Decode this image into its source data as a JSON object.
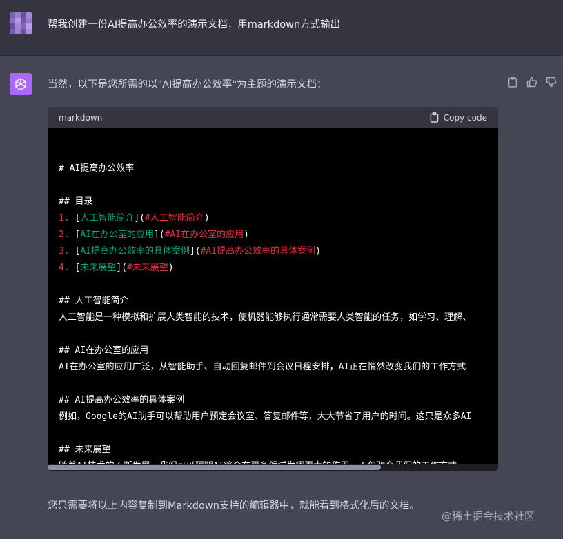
{
  "user": {
    "message": "帮我创建一份AI提高办公效率的演示文档，用markdown方式输出"
  },
  "assistant": {
    "intro": "当然，以下是您所需的以\"AI提高办公效率\"为主题的演示文档：",
    "outro": "您只需要将以上内容复制到Markdown支持的编辑器中，就能看到格式化后的文档。"
  },
  "code": {
    "language": "markdown",
    "copy_label": "Copy code",
    "h1": "# AI提高办公效率",
    "toc_heading": "## 目录",
    "toc": [
      {
        "num": "1.",
        "text": "人工智能简介",
        "href": "#人工智能简介"
      },
      {
        "num": "2.",
        "text": "AI在办公室的应用",
        "href": "#AI在办公室的应用"
      },
      {
        "num": "3.",
        "text": "AI提高办公效率的具体案例",
        "href": "#AI提高办公效率的具体案例"
      },
      {
        "num": "4.",
        "text": "未来展望",
        "href": "#未来展望"
      }
    ],
    "sections": [
      {
        "heading": "## 人工智能简介",
        "body": "人工智能是一种模拟和扩展人类智能的技术，使机器能够执行通常需要人类智能的任务，如学习、理解、"
      },
      {
        "heading": "## AI在办公室的应用",
        "body": "AI在办公室的应用广泛，从智能助手、自动回复邮件到会议日程安排，AI正在悄然改变我们的工作方式"
      },
      {
        "heading": "## AI提高办公效率的具体案例",
        "body": "例如，Google的AI助手可以帮助用户预定会议室、答复邮件等，大大节省了用户的时间。这只是众多AI"
      },
      {
        "heading": "## 未来展望",
        "body": "随着AI技术的不断发展，我们可以预期AI将会在更多领域发挥更大的作用，不仅改变我们的工作方式，"
      }
    ],
    "scroll_fraction": 0.74
  },
  "watermark": "@稀土掘金技术社区",
  "colors": {
    "background": "#444654",
    "user_background": "#343541",
    "code_background": "#000000",
    "heading_number": "#f22c3d",
    "link_text": "#00a67d",
    "assistant_avatar": "#ab68ff"
  },
  "icons": [
    "clipboard-icon",
    "thumbs-up-icon",
    "thumbs-down-icon",
    "openai-logo-icon"
  ]
}
